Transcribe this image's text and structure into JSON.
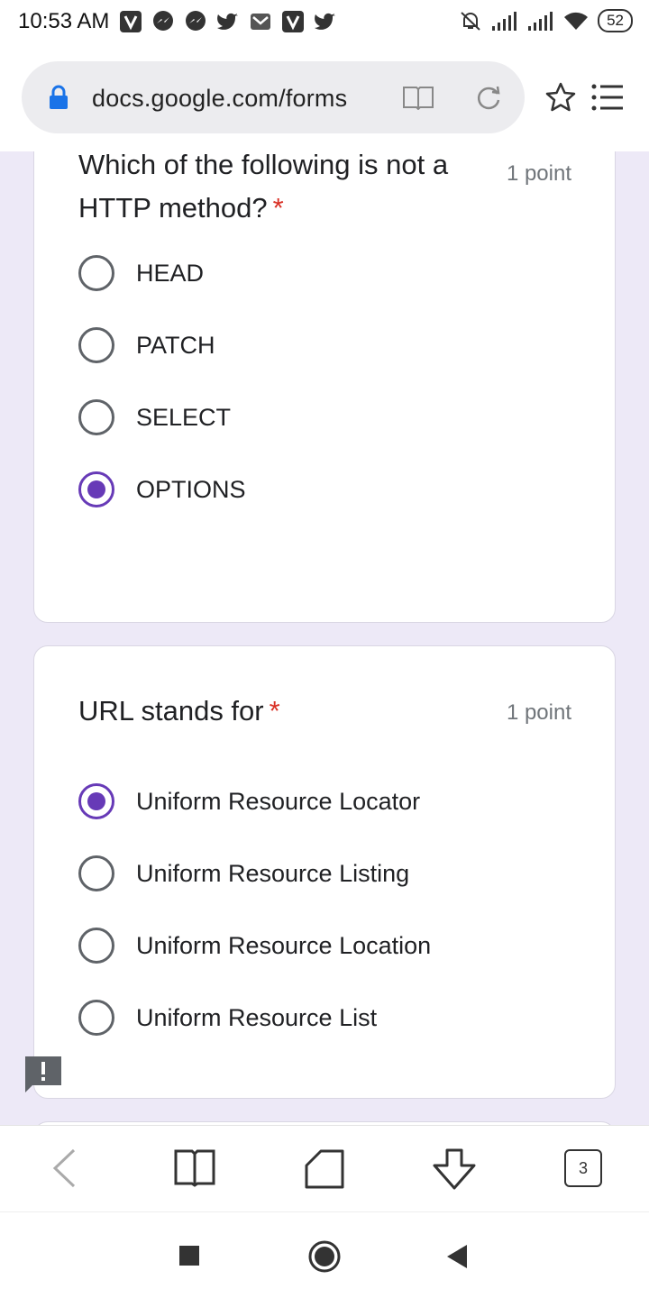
{
  "status_bar": {
    "time": "10:53 AM",
    "battery": "52"
  },
  "browser": {
    "url": "docs.google.com/forms",
    "tab_count": "3"
  },
  "questions": [
    {
      "title": "Which of the following is not a HTTP method?",
      "required_marker": "*",
      "points": "1 point",
      "options": [
        "HEAD",
        "PATCH",
        "SELECT",
        "OPTIONS"
      ],
      "selected": "OPTIONS"
    },
    {
      "title": "URL stands for",
      "required_marker": "*",
      "points": "1 point",
      "options": [
        "Uniform Resource Locator",
        "Uniform Resource Listing",
        "Uniform Resource Location",
        "Uniform Resource List"
      ],
      "selected": "Uniform Resource Locator"
    }
  ],
  "colors": {
    "accent": "#673ab7",
    "page_bg": "#ede9f7",
    "required": "#d93025"
  },
  "icons": [
    "lock-icon",
    "reader-mode-icon",
    "reload-icon",
    "star-icon",
    "menu-icon",
    "feedback-icon",
    "back-icon",
    "bookmarks-icon",
    "home-icon",
    "download-icon",
    "tabs-icon",
    "recents-icon",
    "system-home-icon",
    "system-back-icon"
  ]
}
